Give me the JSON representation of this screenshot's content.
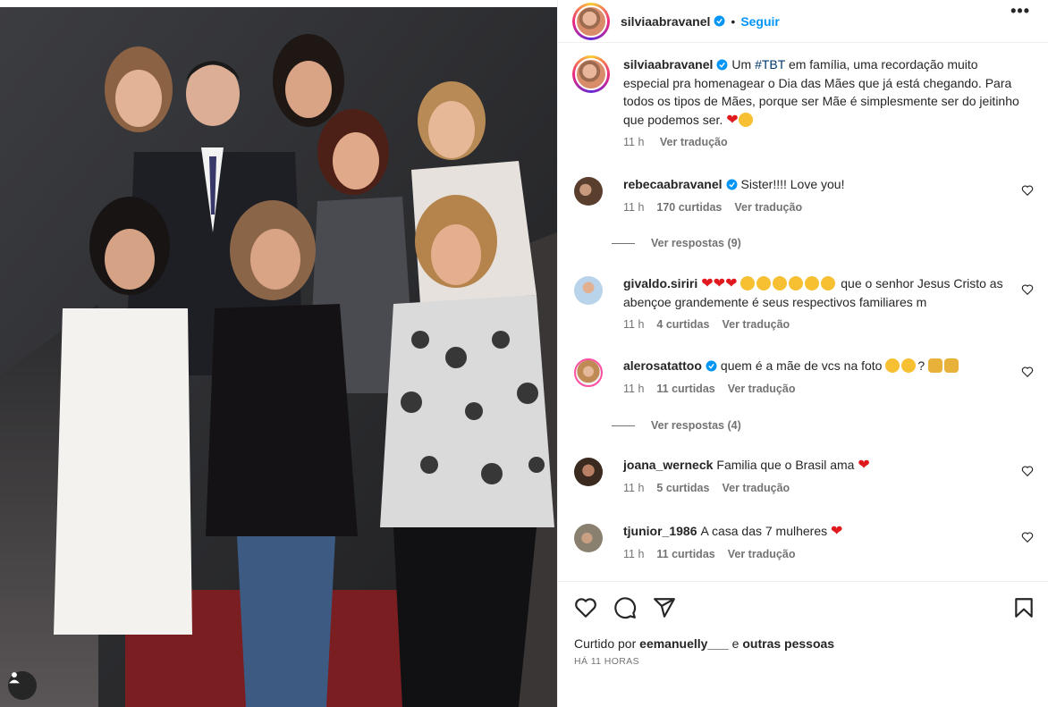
{
  "post": {
    "author": "silviaabravanel",
    "follow_label": "Seguir",
    "more_label": "•••",
    "caption_prefix": "Um ",
    "caption_hashtag": "#TBT",
    "caption_rest": " em família, uma recordação muito especial pra homenagear o Dia das Mães que já está chegando. Para todos os tipos de Mães, porque ser Mãe é simplesmente ser do jeitinho que podemos ser.",
    "caption_time": "11 h",
    "caption_translate": "Ver tradução"
  },
  "comments": [
    {
      "username": "rebecaabravanel",
      "verified": true,
      "text": "Sister!!!! Love you!",
      "time": "11 h",
      "likes": "170 curtidas",
      "translate": "Ver tradução",
      "replies": "Ver respostas (9)"
    },
    {
      "username": "givaldo.siriri",
      "verified": false,
      "text_after_emojis": "que o senhor Jesus Cristo as abençoe grandemente é seus respectivos familiares m",
      "time": "11 h",
      "likes": "4 curtidas",
      "translate": "Ver tradução"
    },
    {
      "username": "alerosatattoo",
      "verified": true,
      "text": "quem é a mãe de vcs na foto",
      "text_q": "?",
      "time": "11 h",
      "likes": "11 curtidas",
      "translate": "Ver tradução",
      "replies": "Ver respostas (4)"
    },
    {
      "username": "joana_werneck",
      "verified": false,
      "text": "Familia que o Brasil ama",
      "time": "11 h",
      "likes": "5 curtidas",
      "translate": "Ver tradução"
    },
    {
      "username": "tjunior_1986",
      "verified": false,
      "text": "A casa das 7 mulheres",
      "time": "11 h",
      "likes": "11 curtidas",
      "translate": "Ver tradução"
    }
  ],
  "footer": {
    "liked_by_prefix": "Curtido por ",
    "liked_by_user": "eemanuelly___",
    "liked_by_and": " e ",
    "liked_by_others": "outras pessoas",
    "timestamp": "HÁ 11 HORAS"
  },
  "colors": {
    "link_blue": "#0095f6",
    "hashtag": "#00376b",
    "muted": "#737373",
    "heart_red": "#e0191f"
  },
  "icons": [
    "heart-icon",
    "comment-icon",
    "share-icon",
    "save-icon",
    "more-icon",
    "verified-icon",
    "user-tag-icon"
  ]
}
